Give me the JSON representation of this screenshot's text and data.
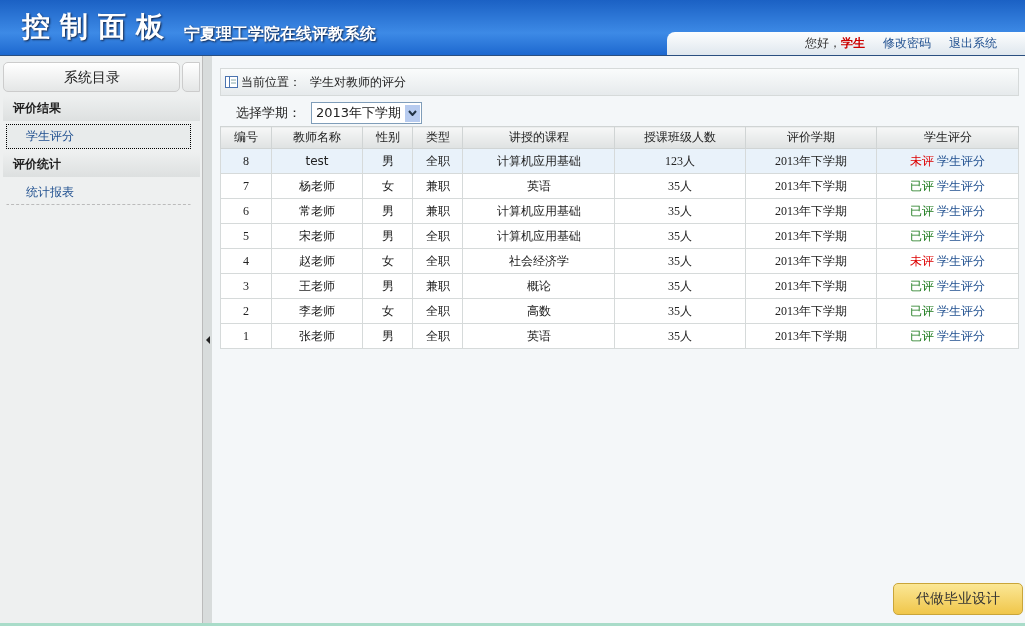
{
  "header": {
    "title": "控制面板",
    "subtitle": "宁夏理工学院在线评教系统",
    "greeting": "您好，",
    "user": "学生",
    "links": [
      "修改密码",
      "退出系统"
    ]
  },
  "sidebar": {
    "title": "系统目录",
    "sections": [
      {
        "label": "评价结果",
        "items": [
          {
            "label": "学生评分",
            "selected": true
          }
        ]
      },
      {
        "label": "评价统计",
        "items": [
          {
            "label": "统计报表",
            "selected": false
          }
        ]
      }
    ]
  },
  "breadcrumb": {
    "label": "当前位置：",
    "page": "学生对教师的评分"
  },
  "term_filter": {
    "label": "选择学期：",
    "value": "2013年下学期"
  },
  "table": {
    "columns": [
      "编号",
      "教师名称",
      "性别",
      "类型",
      "讲授的课程",
      "授课班级人数",
      "评价学期",
      "学生评分"
    ],
    "rows": [
      {
        "cells": [
          "8",
          "test",
          "男",
          "全职",
          "计算机应用基础",
          "123人",
          "2013年下学期"
        ],
        "status": "未评",
        "evaluated": false,
        "action": "学生评分",
        "selected": true
      },
      {
        "cells": [
          "7",
          "杨老师",
          "女",
          "兼职",
          "英语",
          "35人",
          "2013年下学期"
        ],
        "status": "已评",
        "evaluated": true,
        "action": "学生评分",
        "selected": false
      },
      {
        "cells": [
          "6",
          "常老师",
          "男",
          "兼职",
          "计算机应用基础",
          "35人",
          "2013年下学期"
        ],
        "status": "已评",
        "evaluated": true,
        "action": "学生评分",
        "selected": false
      },
      {
        "cells": [
          "5",
          "宋老师",
          "男",
          "全职",
          "计算机应用基础",
          "35人",
          "2013年下学期"
        ],
        "status": "已评",
        "evaluated": true,
        "action": "学生评分",
        "selected": false
      },
      {
        "cells": [
          "4",
          "赵老师",
          "女",
          "全职",
          "社会经济学",
          "35人",
          "2013年下学期"
        ],
        "status": "未评",
        "evaluated": false,
        "action": "学生评分",
        "selected": false
      },
      {
        "cells": [
          "3",
          "王老师",
          "男",
          "兼职",
          "概论",
          "35人",
          "2013年下学期"
        ],
        "status": "已评",
        "evaluated": true,
        "action": "学生评分",
        "selected": false
      },
      {
        "cells": [
          "2",
          "李老师",
          "女",
          "全职",
          "高数",
          "35人",
          "2013年下学期"
        ],
        "status": "已评",
        "evaluated": true,
        "action": "学生评分",
        "selected": false
      },
      {
        "cells": [
          "1",
          "张老师",
          "男",
          "全职",
          "英语",
          "35人",
          "2013年下学期"
        ],
        "status": "已评",
        "evaluated": true,
        "action": "学生评分",
        "selected": false
      }
    ]
  },
  "callout": "代做毕业设计"
}
